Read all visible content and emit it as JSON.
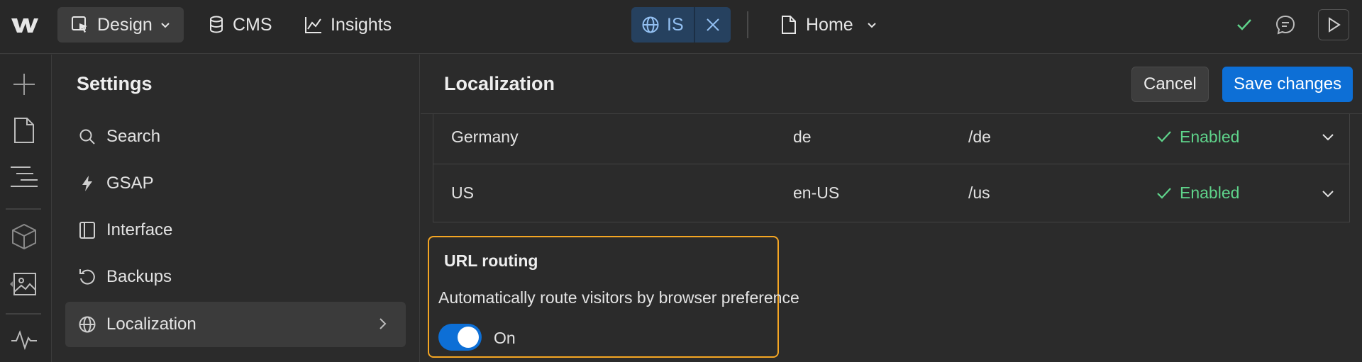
{
  "topbar": {
    "design_label": "Design",
    "cms_label": "CMS",
    "insights_label": "Insights",
    "locale_code": "IS",
    "page_label": "Home"
  },
  "settings": {
    "title": "Settings",
    "items": [
      {
        "label": "Search",
        "icon": "search-icon"
      },
      {
        "label": "GSAP",
        "icon": "bolt-icon"
      },
      {
        "label": "Interface",
        "icon": "panel-icon"
      },
      {
        "label": "Backups",
        "icon": "history-icon"
      },
      {
        "label": "Localization",
        "icon": "globe-icon"
      }
    ]
  },
  "main": {
    "title": "Localization",
    "cancel_label": "Cancel",
    "save_label": "Save changes",
    "locales": [
      {
        "name": "Germany",
        "code": "de",
        "path": "/de",
        "status": "Enabled"
      },
      {
        "name": "US",
        "code": "en-US",
        "path": "/us",
        "status": "Enabled"
      }
    ],
    "routing": {
      "title": "URL routing",
      "description": "Automatically route visitors by browser preference",
      "toggle_label": "On",
      "enabled": true
    }
  },
  "colors": {
    "accent": "#0d6fd6",
    "enabled": "#5fd48b",
    "highlight": "#f5a623"
  }
}
